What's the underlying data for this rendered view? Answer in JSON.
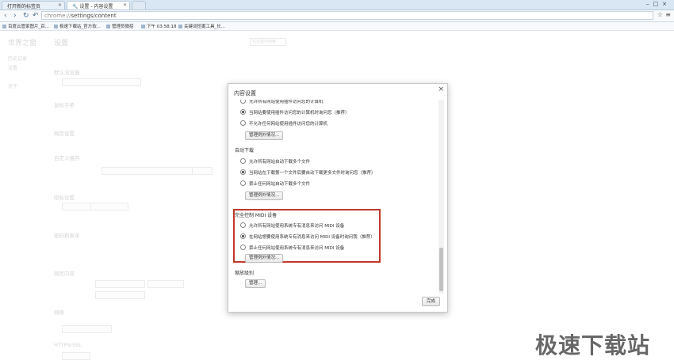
{
  "tabs": [
    {
      "label": "打开新的标签页"
    },
    {
      "label": "设置 - 内容设置"
    }
  ],
  "address": {
    "scheme": "chrome://",
    "path": "settings/content"
  },
  "bookmarks": [
    "百度云管家图片_百...",
    "极速下载站_官方软...",
    "管理员微招",
    "下午 03:58:18",
    "关键词挖掘工具_长..."
  ],
  "settings": {
    "brand": "世界之窗",
    "title": "设置",
    "search_placeholder": "在设置中搜索",
    "nav": [
      "历史记录",
      "设置",
      "关于"
    ],
    "sections": [
      {
        "title": "默认浏览器"
      },
      {
        "title": "鼠标手势"
      },
      {
        "title": "网页设置"
      },
      {
        "title": "自定义缓存"
      },
      {
        "title": "隐私设置"
      },
      {
        "title": "密码和表单"
      },
      {
        "title": "网页内容"
      },
      {
        "title": "网络"
      },
      {
        "title": "HTTPS/SSL"
      }
    ]
  },
  "dialog": {
    "title": "内容设置",
    "groups": [
      {
        "title": "",
        "options": [
          "允许所有网站使用插件访问您的计算机",
          "当网站要使用插件访问您的计算机时询问您（推荐）",
          "不允许任何网站使用插件访问您的计算机"
        ],
        "selected": 1,
        "button": "管理例外情况..."
      },
      {
        "title": "自动下载",
        "options": [
          "允许所有网站自动下载多个文件",
          "当网站在下载第一个文件后要自动下载更多文件时询问您（推荐）",
          "禁止任何网站自动下载多个文件"
        ],
        "selected": 1,
        "button": "管理例外情况..."
      },
      {
        "title": "完全控制 MIDI 设备",
        "options": [
          "允许所有网站使用系统专有消息来访问 MIDI 设备",
          "在网站想要使用系统专有消息来访问 MIDI 设备时询问我（推荐）",
          "禁止任何网站使用系统专有消息来访问 MIDI 设备"
        ],
        "selected": 1,
        "button": "管理例外情况..."
      },
      {
        "title": "缩放级别",
        "options": [],
        "button": "管理..."
      }
    ],
    "done": "完成",
    "highlight_color": "#c0392b"
  },
  "watermark": "极速下载站"
}
